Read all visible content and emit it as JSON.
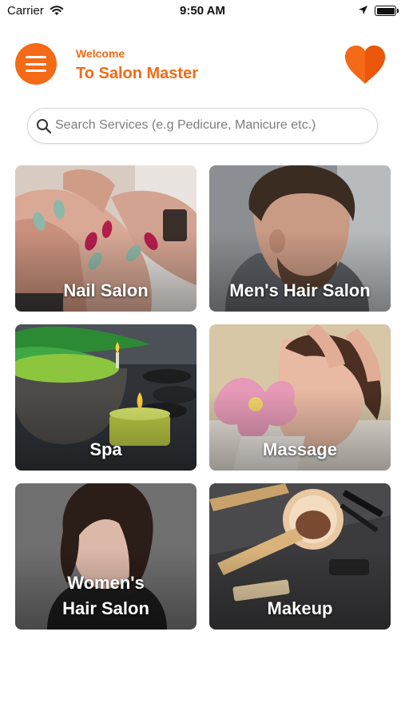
{
  "status_bar": {
    "carrier": "Carrier",
    "time": "9:50 AM"
  },
  "header": {
    "welcome": "Welcome",
    "title": "To Salon Master",
    "menu_icon": "hamburger-menu-icon",
    "favorite_icon": "heart-icon"
  },
  "search": {
    "placeholder": "Search Services (e.g Pedicure, Manicure etc.)",
    "icon": "search-icon"
  },
  "categories": [
    {
      "label": "Nail Salon"
    },
    {
      "label": "Men's Hair Salon"
    },
    {
      "label": "Spa"
    },
    {
      "label": "Massage"
    },
    {
      "label": "Women's\nHair Salon"
    },
    {
      "label": "Makeup"
    }
  ],
  "colors": {
    "accent": "#f46a17",
    "background": "#ffffff",
    "tile_text": "#ffffff"
  }
}
